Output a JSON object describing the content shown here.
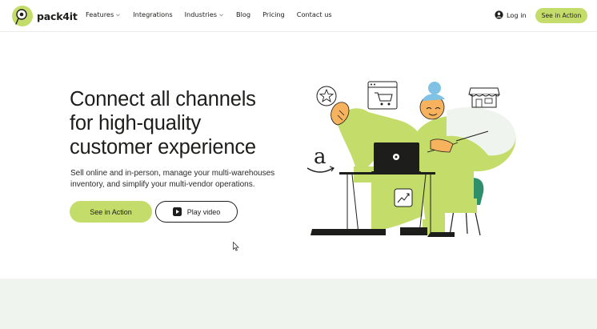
{
  "nav": {
    "brand": "pack4it",
    "links": [
      {
        "label": "Features",
        "has_dropdown": true
      },
      {
        "label": "Integrations",
        "has_dropdown": false
      },
      {
        "label": "Industries",
        "has_dropdown": true
      },
      {
        "label": "Blog",
        "has_dropdown": false
      },
      {
        "label": "Pricing",
        "has_dropdown": false
      },
      {
        "label": "Contact us",
        "has_dropdown": false
      }
    ],
    "login_label": "Log in",
    "cta_label": "See in Action"
  },
  "hero": {
    "title_lines": [
      "Connect all channels",
      "for high-quality",
      "customer experience"
    ],
    "subtitle_lines": [
      "Sell online and in-person, manage your multi-warehouses",
      "inventory, and simplify your multi-vendor operations."
    ],
    "primary_button": "See in Action",
    "secondary_button": "Play video"
  },
  "colors": {
    "accent": "#c4dd6a",
    "text": "#1d1d1b",
    "band": "#f0f4ee",
    "teal": "#2f8f6b",
    "skin": "#f6b25c",
    "hair": "#7fc2e6"
  }
}
